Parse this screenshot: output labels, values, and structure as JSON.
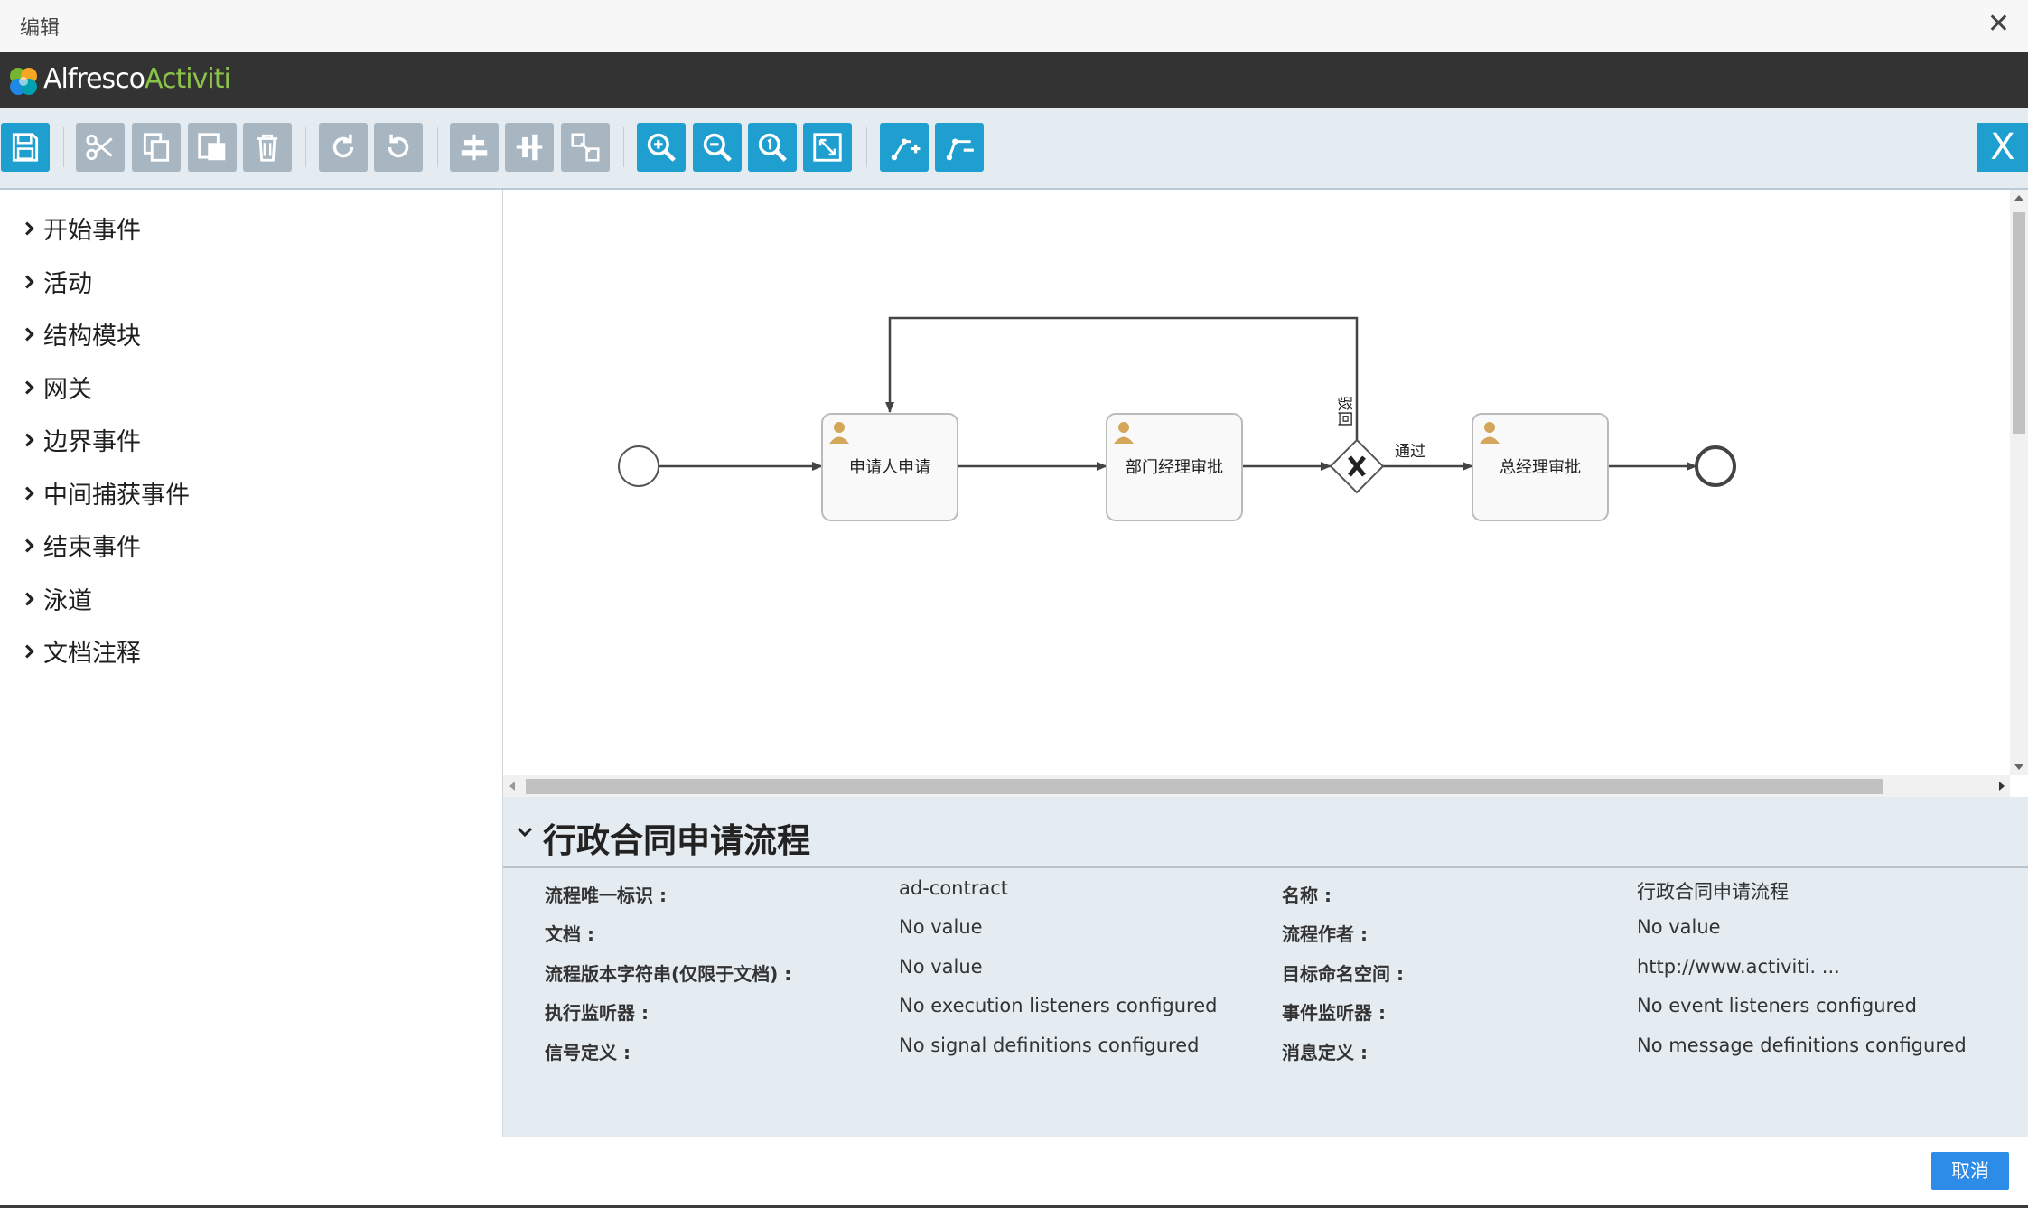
{
  "window": {
    "title": "编辑",
    "close_glyph": "✕"
  },
  "brand": {
    "part1": "Alfresco",
    "part2": "Activiti",
    "logo_icon": "alfresco-flower-icon"
  },
  "toolbar": {
    "buttons": [
      {
        "id": "save",
        "icon": "save-icon"
      },
      {
        "id": "cut",
        "icon": "cut-icon"
      },
      {
        "id": "copy",
        "icon": "copy-icon"
      },
      {
        "id": "paste",
        "icon": "paste-icon"
      },
      {
        "id": "delete",
        "icon": "trash-icon"
      },
      {
        "id": "redo",
        "icon": "redo-icon"
      },
      {
        "id": "undo",
        "icon": "undo-icon"
      },
      {
        "id": "align-horizontal",
        "icon": "align-horizontal-icon"
      },
      {
        "id": "align-vertical",
        "icon": "align-vertical-icon"
      },
      {
        "id": "same-size",
        "icon": "same-size-icon"
      },
      {
        "id": "zoom-in",
        "icon": "zoom-in-icon"
      },
      {
        "id": "zoom-out",
        "icon": "zoom-out-icon"
      },
      {
        "id": "zoom-actual",
        "icon": "zoom-actual-icon"
      },
      {
        "id": "zoom-fit",
        "icon": "zoom-fit-icon"
      },
      {
        "id": "add-bendpoint",
        "icon": "add-bendpoint-icon"
      },
      {
        "id": "remove-bendpoint",
        "icon": "remove-bendpoint-icon"
      }
    ],
    "exit_label": "X"
  },
  "palette": {
    "items": [
      "开始事件",
      "活动",
      "结构模块",
      "网关",
      "边界事件",
      "中间捕获事件",
      "结束事件",
      "泳道",
      "文档注释"
    ]
  },
  "diagram": {
    "tasks": [
      "申请人申请",
      "部门经理审批",
      "总经理审批"
    ],
    "flow_labels": {
      "pass": "通过",
      "reject": "驳回"
    }
  },
  "properties": {
    "title": "行政合同申请流程",
    "rows": [
      {
        "label": "流程唯一标识 :",
        "value": "ad-contract"
      },
      {
        "label": "名称 :",
        "value": "行政合同申请流程"
      },
      {
        "label": "文档 :",
        "value": "No value"
      },
      {
        "label": "流程作者 :",
        "value": "No value"
      },
      {
        "label": "流程版本字符串(仅限于文档) :",
        "value": "No value"
      },
      {
        "label": "目标命名空间 :",
        "value": "http://www.activiti. ..."
      },
      {
        "label": "执行监听器 :",
        "value": "No execution listeners configured"
      },
      {
        "label": "事件监听器 :",
        "value": "No event listeners configured"
      },
      {
        "label": "信号定义 :",
        "value": "No signal definitions configured"
      },
      {
        "label": "消息定义 :",
        "value": "No message definitions configured"
      }
    ]
  },
  "footer": {
    "cancel_label": "取消"
  },
  "colors": {
    "toolbar_bg": "#e4ebf1",
    "grey_button": "#a8b6c2",
    "blue_button": "#1e9fd0",
    "header_bg": "#333333",
    "accent_green": "#8bc34a",
    "cancel_button": "#2d8ce8",
    "task_user_icon": "#d4a65a"
  }
}
